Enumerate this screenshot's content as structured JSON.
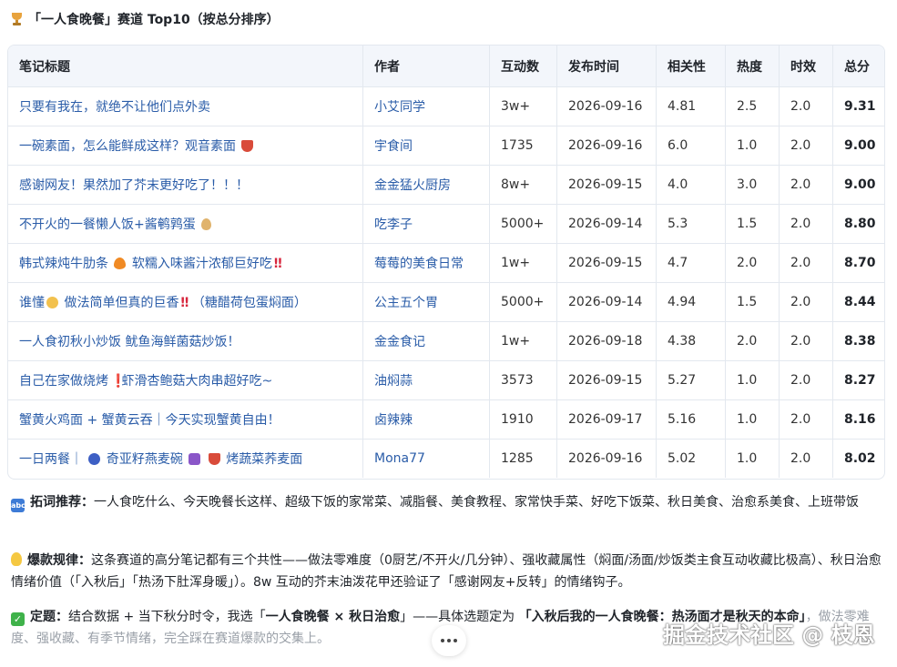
{
  "title": "「一人食晚餐」赛道 Top10（按总分排序）",
  "table": {
    "headers": [
      "笔记标题",
      "作者",
      "互动数",
      "发布时间",
      "相关性",
      "热度",
      "时效",
      "总分"
    ],
    "rows": [
      {
        "title": "只要有我在，就绝不让他们点外卖",
        "emoji": [],
        "author": "小艾同学",
        "interactions": "3w+",
        "date": "2026-09-16",
        "relevance": "4.81",
        "heat": "2.5",
        "timeliness": "2.0",
        "total": "9.31"
      },
      {
        "title": "一碗素面，怎么能鲜成这样？观音素面",
        "emoji": [
          "bowl-emoji"
        ],
        "author": "宇食间",
        "interactions": "1735",
        "date": "2026-09-16",
        "relevance": "6.0",
        "heat": "1.0",
        "timeliness": "2.0",
        "total": "9.00"
      },
      {
        "title": "感谢网友！果然加了芥末更好吃了！！！",
        "emoji": [],
        "author": "金金猛火厨房",
        "interactions": "8w+",
        "date": "2026-09-15",
        "relevance": "4.0",
        "heat": "3.0",
        "timeliness": "2.0",
        "total": "9.00"
      },
      {
        "title": "不开火的一餐懒人饭+酱鹌鹑蛋",
        "emoji": [
          "egg-emoji"
        ],
        "author": "吃李子",
        "interactions": "5000+",
        "date": "2026-09-14",
        "relevance": "5.3",
        "heat": "1.5",
        "timeliness": "2.0",
        "total": "8.80"
      },
      {
        "title_a": "韩式辣炖牛肋条",
        "title_b": "软糯入味酱汁浓郁巨好吃",
        "author": "莓莓的美食日常",
        "interactions": "1w+",
        "date": "2026-09-15",
        "relevance": "4.7",
        "heat": "2.0",
        "timeliness": "2.0",
        "total": "8.70"
      },
      {
        "title_a": "谁懂",
        "title_b": "做法简单但真的巨香",
        "title_c": "（糖醋荷包蛋焖面）",
        "author": "公主五个胃",
        "interactions": "5000+",
        "date": "2026-09-14",
        "relevance": "4.94",
        "heat": "1.5",
        "timeliness": "2.0",
        "total": "8.44"
      },
      {
        "title": "一人食初秋小炒饭 鱿鱼海鲜菌菇炒饭！",
        "emoji": [],
        "author": "金金食记",
        "interactions": "1w+",
        "date": "2026-09-18",
        "relevance": "4.38",
        "heat": "2.0",
        "timeliness": "2.0",
        "total": "8.38"
      },
      {
        "title_a": "自己在家做烧烤",
        "title_b": "虾滑杏鲍菇大肉串超好吃~",
        "author": "油焖蒜",
        "interactions": "3573",
        "date": "2026-09-15",
        "relevance": "5.27",
        "heat": "1.0",
        "timeliness": "2.0",
        "total": "8.27"
      },
      {
        "title": "蟹黄火鸡面 + 蟹黄云吞｜今天实现蟹黄自由！",
        "emoji": [],
        "author": "卤辣辣",
        "interactions": "1910",
        "date": "2026-09-17",
        "relevance": "5.16",
        "heat": "1.0",
        "timeliness": "2.0",
        "total": "8.16"
      },
      {
        "title_a": "一日两餐｜",
        "title_b": "奇亚籽燕麦碗",
        "title_c": "烤蔬菜荞麦面",
        "author": "Mona77",
        "interactions": "1285",
        "date": "2026-09-16",
        "relevance": "5.02",
        "heat": "1.0",
        "timeliness": "2.0",
        "total": "8.02"
      }
    ]
  },
  "keywords": {
    "label": "拓词推荐：",
    "text": "一人食吃什么、今天晚餐长这样、超级下饭的家常菜、减脂餐、美食教程、家常快手菜、好吃下饭菜、秋日美食、治愈系美食、上班带饭"
  },
  "rules": {
    "label": "爆款规律：",
    "text": "这条赛道的高分笔记都有三个共性——做法零难度（0厨艺/不开火/几分钟）、强收藏属性（焖面/汤面/炒饭类主食互动收藏比极高）、秋日治愈情绪价值（「入秋后」「热汤下肚浑身暖」）。8w 互动的芥末油泼花甲还验证了「感谢网友+反转」的情绪钩子。"
  },
  "decision": {
    "label": "定题：",
    "text_a": "结合数据 + 当下秋分时令，我选「",
    "highlight_a": "一人食晚餐 × 秋日治愈",
    "text_b": "」——具体选题定为 ",
    "highlight_b": "「入秋后我的一人食晚餐：热汤面才是秋天的本命」",
    "text_c": "，做法零难度、强收藏、有季节情绪，完全踩在赛道爆款的交集上。"
  },
  "watermark": "掘金技术社区 @ 枝恩",
  "colors": {
    "link": "#2a5ca8",
    "header_bg": "#f3f6fb",
    "border": "#e3e8ef"
  }
}
